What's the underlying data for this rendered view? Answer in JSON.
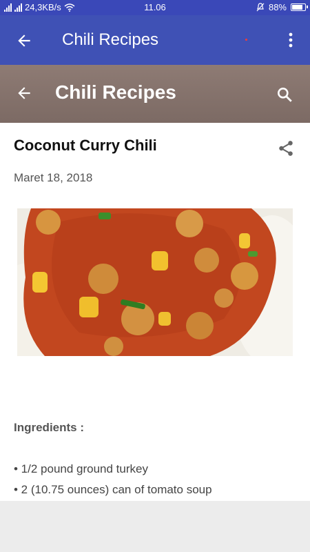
{
  "status_bar": {
    "speed": "24,3KB/s",
    "time": "11.06",
    "battery": "88%"
  },
  "app_bar": {
    "title": "Chili Recipes"
  },
  "web_header": {
    "title": "Chili Recipes"
  },
  "post": {
    "title": "Coconut Curry Chili",
    "date": "Maret 18, 2018",
    "ingredients_label": "Ingredients :",
    "ingredients": [
      "• 1/2 pound ground turkey",
      "• 2 (10.75 ounces) can of tomato soup"
    ]
  },
  "colors": {
    "app_bar": "#3f51b5",
    "web_header": "#86746d"
  }
}
